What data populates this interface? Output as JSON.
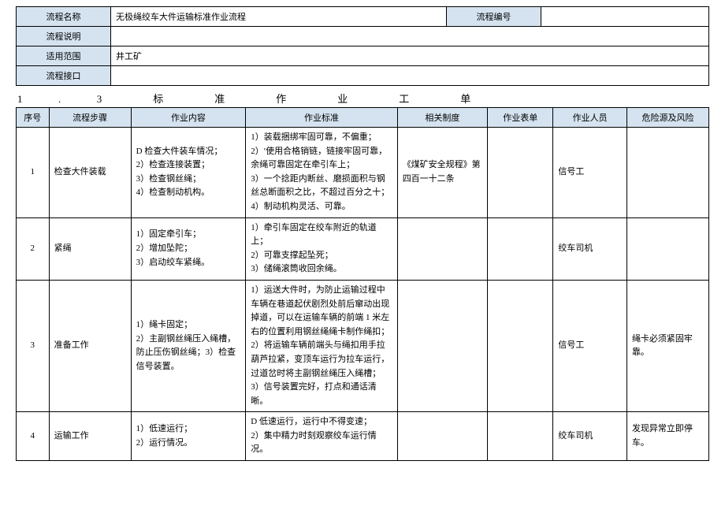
{
  "meta": {
    "labels": {
      "name": "流程名称",
      "code": "流程编号",
      "desc": "流程说明",
      "scope": "适用范围",
      "iface": "流程接口"
    },
    "values": {
      "name": "无极绳绞车大件运输标准作业流程",
      "code": "",
      "desc": "",
      "scope": "井工矿",
      "iface": ""
    }
  },
  "section_title": "1              .              3                    标                    准                    作                    业                    工                    单",
  "headers": {
    "seq": "序号",
    "step": "流程步骤",
    "content": "作业内容",
    "standard": "作业标准",
    "regs": "相关制度",
    "form": "作业表单",
    "staff": "作业人员",
    "risk": "危险源及风险"
  },
  "rows": [
    {
      "seq": "1",
      "step": "检查大件装载",
      "content": "D 检查大件装车情况；\n2）检查连接装置；\n3）检查钢丝绳；\n4）检查制动机构。",
      "standard": "1）装载捆绑牢固可靠，不偏重；\n2）′使用合格销链，链接牢固可靠，余绳可靠固定在牵引车上；\n3）一个捻距内断丝、磨损面积与钢丝总断面积之比，不超过百分之十；\n4）制动机构灵活、可靠。",
      "regs": "《煤矿安全规程》第四百一十二条",
      "form": "",
      "staff": "信号工",
      "risk": ""
    },
    {
      "seq": "2",
      "step": "紧绳",
      "content": "1）固定牵引车；\n2）增加坠陀；\n3）启动绞车紧绳。",
      "standard": "1）牵引车固定在绞车附近的轨道上；\n2）可靠支撑起坠死；\n3）储绳滚筒收回余绳。",
      "regs": "",
      "form": "",
      "staff": "绞车司机",
      "risk": ""
    },
    {
      "seq": "3",
      "step": "准备工作",
      "content": "1）绳卡固定；\n2）主副钢丝绳压入绳槽，防止压伤钢丝绳；3）检查信号装置。",
      "standard": "1）运送大件时，为防止运输过程中车辆在巷道起伏剧烈处前后窜动出现掉道，可以在运输车辆的前端 1 米左右的位置利用钢丝绳绳卡制作绳扣；2）将运输车辆前端头与绳扣用手拉葫芦拉紧，变顶车运行为拉车运行，过道岔时将主副钢丝绳压入绳槽；\n3）信号装置完好，打点和通话清晰。",
      "regs": "",
      "form": "",
      "staff": "信号工",
      "risk": "绳卡必须紧固牢靠。"
    },
    {
      "seq": "4",
      "step": "运输工作",
      "content": "1）低速运行；\n2）运行情况。",
      "standard": "D 低速运行，运行中不得变速；\n2）集中精力时刻观察绞车运行情况。",
      "regs": "",
      "form": "",
      "staff": "绞车司机",
      "risk": "发现异常立即停 车。"
    }
  ]
}
